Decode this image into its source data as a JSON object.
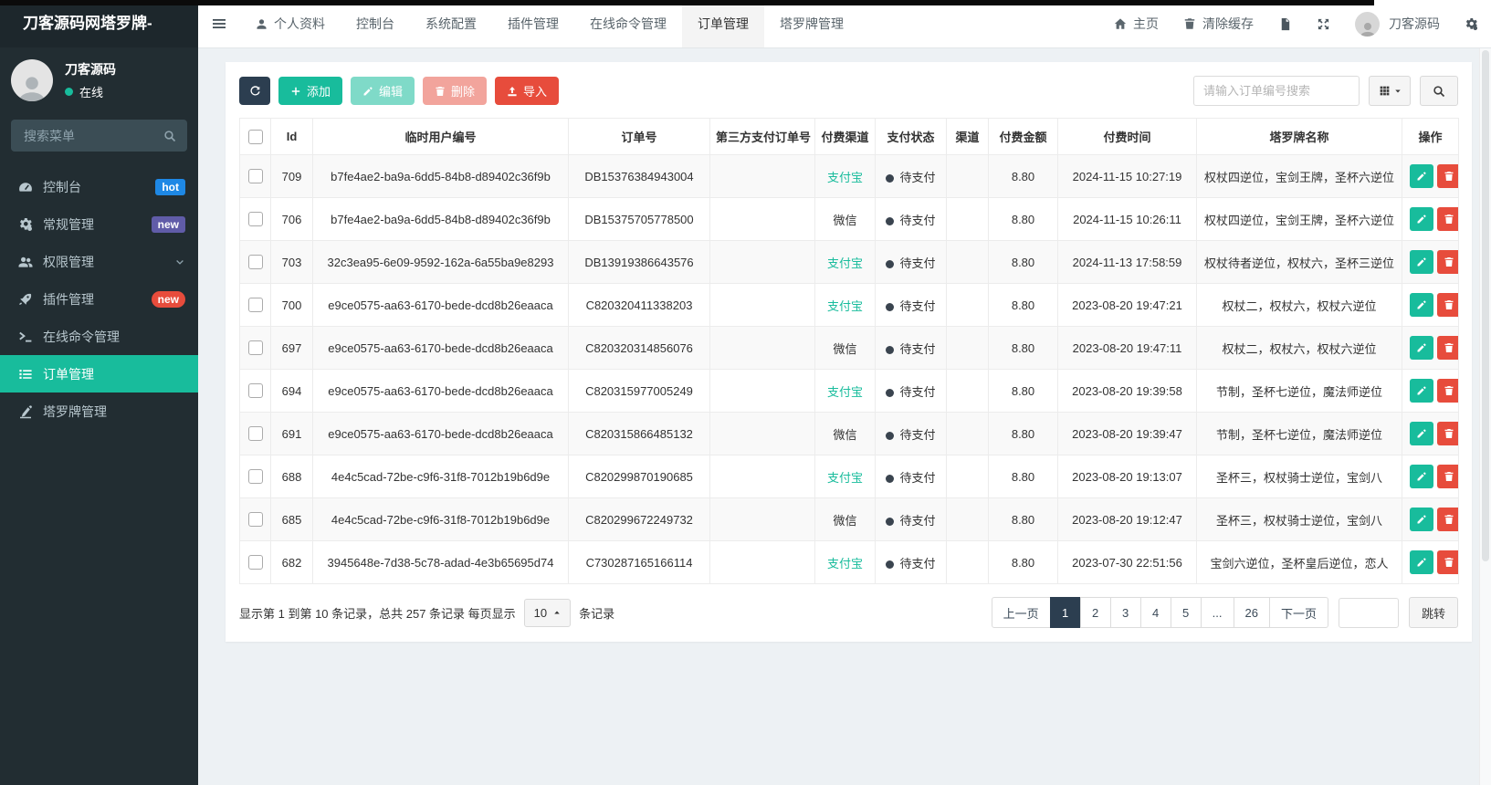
{
  "colors": {
    "accent": "#18bc9c",
    "dark": "#2c3e50",
    "danger": "#e74c3c",
    "sidebar_bg": "#222d32",
    "badge_hot": "#1e88e5",
    "badge_new_purple": "#605ca8",
    "badge_new_red": "#e74c3c"
  },
  "sidebar": {
    "brand": "刀客源码网塔罗牌-",
    "user": {
      "name": "刀客源码",
      "status": "在线"
    },
    "search_placeholder": "搜索菜单",
    "items": [
      {
        "key": "console",
        "label": "控制台",
        "icon": "dashboard-icon",
        "badge": "hot",
        "badge_style": "hot"
      },
      {
        "key": "general",
        "label": "常规管理",
        "icon": "cogs-icon",
        "badge": "new",
        "badge_style": "new-purple"
      },
      {
        "key": "auth",
        "label": "权限管理",
        "icon": "users-icon",
        "chevron": true
      },
      {
        "key": "addon",
        "label": "插件管理",
        "icon": "rocket-icon",
        "badge": "new",
        "badge_style": "new-red"
      },
      {
        "key": "command",
        "label": "在线命令管理",
        "icon": "terminal-icon"
      },
      {
        "key": "order",
        "label": "订单管理",
        "icon": "list-icon",
        "active": true
      },
      {
        "key": "tarot",
        "label": "塔罗牌管理",
        "icon": "pen-icon"
      }
    ]
  },
  "topbar": {
    "tabs": [
      {
        "key": "profile",
        "label": "个人资料",
        "icon": "user-icon"
      },
      {
        "key": "console",
        "label": "控制台"
      },
      {
        "key": "config",
        "label": "系统配置"
      },
      {
        "key": "addon",
        "label": "插件管理"
      },
      {
        "key": "command",
        "label": "在线命令管理"
      },
      {
        "key": "order",
        "label": "订单管理",
        "active": true
      },
      {
        "key": "tarot",
        "label": "塔罗牌管理"
      }
    ],
    "home_label": "主页",
    "clear_cache_label": "清除缓存",
    "username": "刀客源码"
  },
  "toolbar": {
    "add_label": "添加",
    "edit_label": "编辑",
    "delete_label": "删除",
    "import_label": "导入",
    "search_placeholder": "请输入订单编号搜索"
  },
  "table": {
    "columns": [
      "Id",
      "临时用户编号",
      "订单号",
      "第三方支付订单号",
      "付费渠道",
      "支付状态",
      "渠道",
      "付费金额",
      "付费时间",
      "塔罗牌名称",
      "操作"
    ],
    "rows": [
      {
        "id": "709",
        "user_no": "b7fe4ae2-ba9a-6dd5-84b8-d89402c36f9b",
        "order_no": "DB15376384943004",
        "third_no": "",
        "channel": "支付宝",
        "channel_style": "alipay",
        "status": "待支付",
        "sub_channel": "",
        "amount": "8.80",
        "time": "2024-11-15 10:27:19",
        "tarot": "权杖四逆位，宝剑王牌，圣杯六逆位"
      },
      {
        "id": "706",
        "user_no": "b7fe4ae2-ba9a-6dd5-84b8-d89402c36f9b",
        "order_no": "DB15375705778500",
        "third_no": "",
        "channel": "微信",
        "channel_style": "wechat",
        "status": "待支付",
        "sub_channel": "",
        "amount": "8.80",
        "time": "2024-11-15 10:26:11",
        "tarot": "权杖四逆位，宝剑王牌，圣杯六逆位"
      },
      {
        "id": "703",
        "user_no": "32c3ea95-6e09-9592-162a-6a55ba9e8293",
        "order_no": "DB13919386643576",
        "third_no": "",
        "channel": "支付宝",
        "channel_style": "alipay",
        "status": "待支付",
        "sub_channel": "",
        "amount": "8.80",
        "time": "2024-11-13 17:58:59",
        "tarot": "权杖待者逆位，权杖六，圣杯三逆位"
      },
      {
        "id": "700",
        "user_no": "e9ce0575-aa63-6170-bede-dcd8b26eaaca",
        "order_no": "C820320411338203",
        "third_no": "",
        "channel": "支付宝",
        "channel_style": "alipay",
        "status": "待支付",
        "sub_channel": "",
        "amount": "8.80",
        "time": "2023-08-20 19:47:21",
        "tarot": "权杖二，权杖六，权杖六逆位"
      },
      {
        "id": "697",
        "user_no": "e9ce0575-aa63-6170-bede-dcd8b26eaaca",
        "order_no": "C820320314856076",
        "third_no": "",
        "channel": "微信",
        "channel_style": "wechat",
        "status": "待支付",
        "sub_channel": "",
        "amount": "8.80",
        "time": "2023-08-20 19:47:11",
        "tarot": "权杖二，权杖六，权杖六逆位"
      },
      {
        "id": "694",
        "user_no": "e9ce0575-aa63-6170-bede-dcd8b26eaaca",
        "order_no": "C820315977005249",
        "third_no": "",
        "channel": "支付宝",
        "channel_style": "alipay",
        "status": "待支付",
        "sub_channel": "",
        "amount": "8.80",
        "time": "2023-08-20 19:39:58",
        "tarot": "节制，圣杯七逆位，魔法师逆位"
      },
      {
        "id": "691",
        "user_no": "e9ce0575-aa63-6170-bede-dcd8b26eaaca",
        "order_no": "C820315866485132",
        "third_no": "",
        "channel": "微信",
        "channel_style": "wechat",
        "status": "待支付",
        "sub_channel": "",
        "amount": "8.80",
        "time": "2023-08-20 19:39:47",
        "tarot": "节制，圣杯七逆位，魔法师逆位"
      },
      {
        "id": "688",
        "user_no": "4e4c5cad-72be-c9f6-31f8-7012b19b6d9e",
        "order_no": "C820299870190685",
        "third_no": "",
        "channel": "支付宝",
        "channel_style": "alipay",
        "status": "待支付",
        "sub_channel": "",
        "amount": "8.80",
        "time": "2023-08-20 19:13:07",
        "tarot": "圣杯三，权杖骑士逆位，宝剑八"
      },
      {
        "id": "685",
        "user_no": "4e4c5cad-72be-c9f6-31f8-7012b19b6d9e",
        "order_no": "C820299672249732",
        "third_no": "",
        "channel": "微信",
        "channel_style": "wechat",
        "status": "待支付",
        "sub_channel": "",
        "amount": "8.80",
        "time": "2023-08-20 19:12:47",
        "tarot": "圣杯三，权杖骑士逆位，宝剑八"
      },
      {
        "id": "682",
        "user_no": "3945648e-7d38-5c78-adad-4e3b65695d74",
        "order_no": "C730287165166114",
        "third_no": "",
        "channel": "支付宝",
        "channel_style": "alipay",
        "status": "待支付",
        "sub_channel": "",
        "amount": "8.80",
        "time": "2023-07-30 22:51:56",
        "tarot": "宝剑六逆位，圣杯皇后逆位，恋人"
      }
    ]
  },
  "pagination": {
    "info_prefix": "显示第 1 到第 10 条记录，总共 257 条记录 每页显示",
    "page_size": "10",
    "info_suffix": "条记录",
    "pages": [
      {
        "key": "prev",
        "label": "上一页"
      },
      {
        "key": "1",
        "label": "1",
        "active": true
      },
      {
        "key": "2",
        "label": "2"
      },
      {
        "key": "3",
        "label": "3"
      },
      {
        "key": "4",
        "label": "4"
      },
      {
        "key": "5",
        "label": "5"
      },
      {
        "key": "ellipsis",
        "label": "..."
      },
      {
        "key": "26",
        "label": "26"
      },
      {
        "key": "next",
        "label": "下一页"
      }
    ],
    "jump_value": "",
    "jump_label": "跳转"
  }
}
